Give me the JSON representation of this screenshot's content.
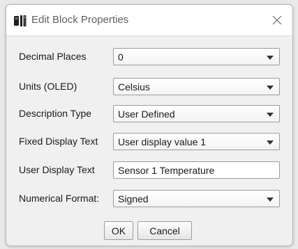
{
  "window": {
    "title": "Edit Block Properties",
    "icon": "block-app-icon",
    "close_icon": "close-icon"
  },
  "fields": [
    {
      "label": "Decimal Places",
      "type": "select",
      "value": "0"
    },
    {
      "label": "Units (OLED)",
      "type": "select",
      "value": "Celsius"
    },
    {
      "label": "Description Type",
      "type": "select",
      "value": "User Defined"
    },
    {
      "label": "Fixed Display Text",
      "type": "select",
      "value": "User display value 1"
    },
    {
      "label": "User Display Text",
      "type": "text",
      "value": "Sensor 1 Temperature"
    },
    {
      "label": "Numerical Format:",
      "type": "select",
      "value": "Signed"
    }
  ],
  "buttons": {
    "ok": "OK",
    "cancel": "Cancel"
  }
}
